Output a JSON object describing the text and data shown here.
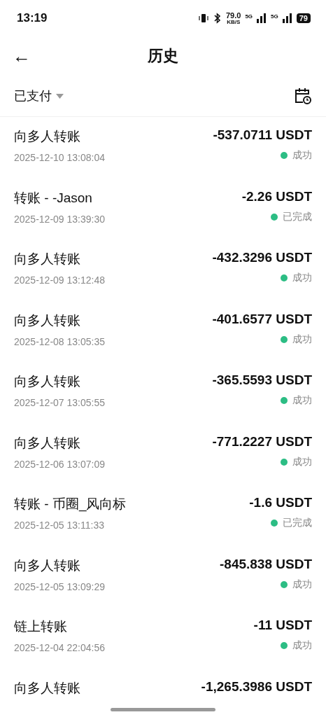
{
  "status_bar": {
    "time": "13:19",
    "speed": "79.0",
    "speed_unit": "KB/S",
    "network_1": "5G",
    "network_2": "5G",
    "battery": "79"
  },
  "header": {
    "back": "←",
    "title": "历史"
  },
  "filter": {
    "label": "已支付"
  },
  "transactions": [
    {
      "title": "向多人转账",
      "date": "2025-12-10 13:08:04",
      "amount": "-537.0711 USDT",
      "status": "成功"
    },
    {
      "title": "转账 - -Jason",
      "date": "2025-12-09 13:39:30",
      "amount": "-2.26 USDT",
      "status": "已完成"
    },
    {
      "title": "向多人转账",
      "date": "2025-12-09 13:12:48",
      "amount": "-432.3296 USDT",
      "status": "成功"
    },
    {
      "title": "向多人转账",
      "date": "2025-12-08 13:05:35",
      "amount": "-401.6577 USDT",
      "status": "成功"
    },
    {
      "title": "向多人转账",
      "date": "2025-12-07 13:05:55",
      "amount": "-365.5593 USDT",
      "status": "成功"
    },
    {
      "title": "向多人转账",
      "date": "2025-12-06 13:07:09",
      "amount": "-771.2227 USDT",
      "status": "成功"
    },
    {
      "title": "转账 - 币圈_风向标",
      "date": "2025-12-05 13:11:33",
      "amount": "-1.6 USDT",
      "status": "已完成"
    },
    {
      "title": "向多人转账",
      "date": "2025-12-05 13:09:29",
      "amount": "-845.838 USDT",
      "status": "成功"
    },
    {
      "title": "链上转账",
      "date": "2025-12-04 22:04:56",
      "amount": "-11 USDT",
      "status": "成功"
    },
    {
      "title": "向多人转账",
      "amount": "-1,265.3986 USDT"
    }
  ]
}
